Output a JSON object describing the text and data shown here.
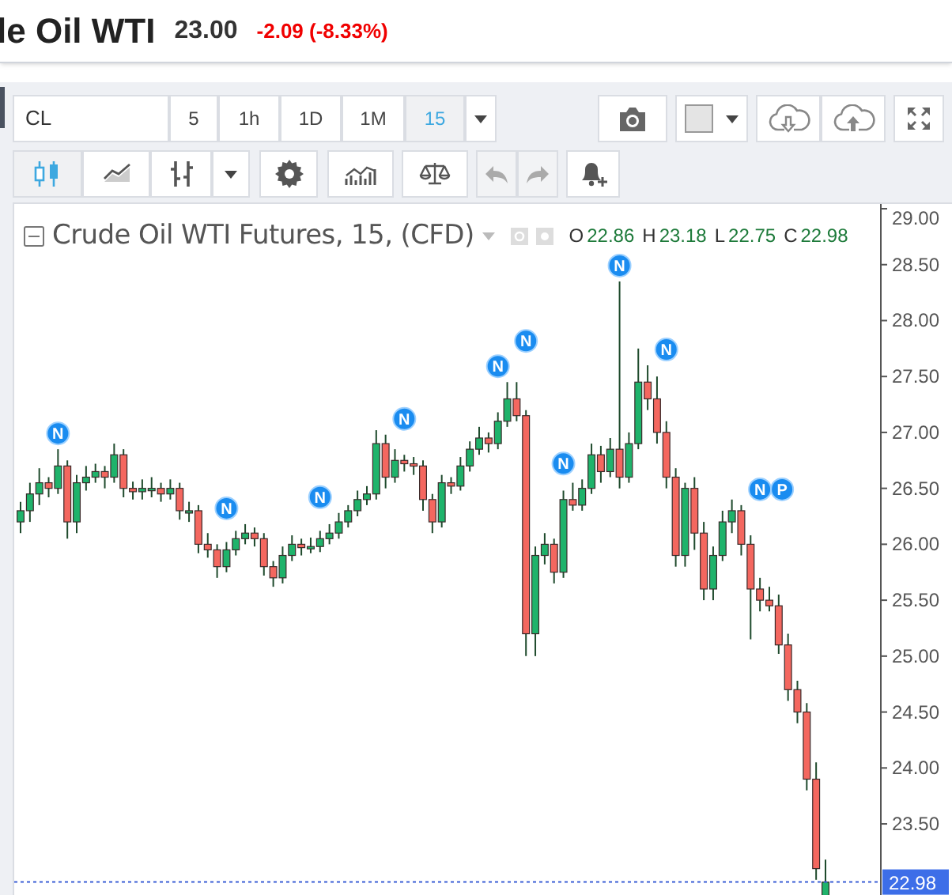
{
  "header": {
    "title": "le Oil WTI",
    "price": "23.00",
    "change": "-2.09 (-8.33%)"
  },
  "toolbar": {
    "symbol": "CL",
    "intervals": [
      {
        "label": "5",
        "selected": false
      },
      {
        "label": "1h",
        "selected": false
      },
      {
        "label": "1D",
        "selected": false
      },
      {
        "label": "1M",
        "selected": false
      },
      {
        "label": "15",
        "selected": true
      }
    ],
    "chart_types": [
      {
        "kind": "candles",
        "selected": true
      },
      {
        "kind": "line",
        "selected": false
      },
      {
        "kind": "bars",
        "selected": false
      }
    ]
  },
  "legend": {
    "title": "Crude Oil WTI Futures, 15, (CFD)",
    "ohlc": [
      {
        "key": "O",
        "value": "22.86"
      },
      {
        "key": "H",
        "value": "23.18"
      },
      {
        "key": "L",
        "value": "22.75"
      },
      {
        "key": "C",
        "value": "22.98"
      }
    ]
  },
  "chart_data": {
    "type": "candlestick",
    "ylim": [
      22.85,
      29.05
    ],
    "ref_lines": [
      {
        "axis": "y",
        "value": 22.98,
        "label": "22.98",
        "color": "#3b5fd6"
      }
    ],
    "yticks": [
      {
        "value": 29,
        "label": "29.00"
      },
      {
        "value": 28.5,
        "label": "28.50"
      },
      {
        "value": 28,
        "label": "28.00"
      },
      {
        "value": 27.5,
        "label": "27.50"
      },
      {
        "value": 27,
        "label": "27.00"
      },
      {
        "value": 26.5,
        "label": "26.50"
      },
      {
        "value": 26,
        "label": "26.00"
      },
      {
        "value": 25.5,
        "label": "25.50"
      },
      {
        "value": 25,
        "label": "25.00"
      },
      {
        "value": 24.5,
        "label": "24.50"
      },
      {
        "value": 24,
        "label": "24.00"
      },
      {
        "value": 23.5,
        "label": "23.50"
      }
    ],
    "ohlc": [
      [
        26.2,
        26.38,
        26.1,
        26.3
      ],
      [
        26.3,
        26.55,
        26.2,
        26.45
      ],
      [
        26.45,
        26.68,
        26.35,
        26.55
      ],
      [
        26.55,
        26.6,
        26.42,
        26.5
      ],
      [
        26.5,
        26.85,
        26.45,
        26.7
      ],
      [
        26.7,
        26.75,
        26.05,
        26.2
      ],
      [
        26.2,
        26.62,
        26.1,
        26.55
      ],
      [
        26.55,
        26.7,
        26.48,
        26.6
      ],
      [
        26.6,
        26.72,
        26.55,
        26.65
      ],
      [
        26.65,
        26.7,
        26.5,
        26.6
      ],
      [
        26.6,
        26.9,
        26.55,
        26.8
      ],
      [
        26.8,
        26.85,
        26.42,
        26.5
      ],
      [
        26.5,
        26.56,
        26.4,
        26.47
      ],
      [
        26.47,
        26.58,
        26.4,
        26.5
      ],
      [
        26.5,
        26.6,
        26.42,
        26.5
      ],
      [
        26.5,
        26.55,
        26.38,
        26.45
      ],
      [
        26.45,
        26.58,
        26.4,
        26.5
      ],
      [
        26.5,
        26.55,
        26.22,
        26.3
      ],
      [
        26.3,
        26.38,
        26.2,
        26.3
      ],
      [
        26.3,
        26.35,
        25.92,
        26.0
      ],
      [
        26.0,
        26.1,
        25.88,
        25.95
      ],
      [
        25.95,
        26.0,
        25.7,
        25.8
      ],
      [
        25.8,
        26.02,
        25.75,
        25.95
      ],
      [
        25.95,
        26.12,
        25.9,
        26.05
      ],
      [
        26.05,
        26.18,
        26.0,
        26.1
      ],
      [
        26.1,
        26.15,
        25.98,
        26.05
      ],
      [
        26.05,
        26.1,
        25.72,
        25.8
      ],
      [
        25.8,
        25.85,
        25.62,
        25.7
      ],
      [
        25.7,
        25.98,
        25.65,
        25.9
      ],
      [
        25.9,
        26.08,
        25.85,
        26.0
      ],
      [
        26.0,
        26.05,
        25.9,
        25.97
      ],
      [
        25.97,
        26.06,
        25.92,
        25.98
      ],
      [
        25.98,
        26.12,
        25.93,
        26.05
      ],
      [
        26.05,
        26.18,
        26.0,
        26.1
      ],
      [
        26.1,
        26.28,
        26.05,
        26.2
      ],
      [
        26.2,
        26.35,
        26.15,
        26.3
      ],
      [
        26.3,
        26.48,
        26.25,
        26.4
      ],
      [
        26.4,
        26.52,
        26.35,
        26.45
      ],
      [
        26.45,
        27.02,
        26.4,
        26.9
      ],
      [
        26.9,
        26.98,
        26.5,
        26.6
      ],
      [
        26.6,
        26.85,
        26.55,
        26.75
      ],
      [
        26.75,
        26.8,
        26.65,
        26.72
      ],
      [
        26.72,
        26.78,
        26.62,
        26.7
      ],
      [
        26.7,
        26.75,
        26.3,
        26.4
      ],
      [
        26.4,
        26.45,
        26.1,
        26.2
      ],
      [
        26.2,
        26.62,
        26.15,
        26.55
      ],
      [
        26.55,
        26.6,
        26.45,
        26.52
      ],
      [
        26.52,
        26.78,
        26.48,
        26.7
      ],
      [
        26.7,
        26.92,
        26.65,
        26.85
      ],
      [
        26.85,
        27.05,
        26.8,
        26.95
      ],
      [
        26.95,
        27.0,
        26.82,
        26.9
      ],
      [
        26.9,
        27.18,
        26.85,
        27.1
      ],
      [
        27.1,
        27.45,
        27.05,
        27.3
      ],
      [
        27.3,
        27.45,
        27.1,
        27.15
      ],
      [
        27.15,
        27.2,
        25.0,
        25.2
      ],
      [
        25.2,
        25.98,
        25.0,
        25.9
      ],
      [
        25.9,
        26.1,
        25.82,
        26.0
      ],
      [
        26.0,
        26.05,
        25.65,
        25.75
      ],
      [
        25.75,
        26.48,
        25.7,
        26.4
      ],
      [
        26.4,
        26.55,
        26.3,
        26.35
      ],
      [
        26.35,
        26.58,
        26.3,
        26.5
      ],
      [
        26.5,
        26.9,
        26.45,
        26.8
      ],
      [
        26.8,
        26.88,
        26.55,
        26.65
      ],
      [
        26.65,
        26.95,
        26.6,
        26.85
      ],
      [
        26.85,
        28.35,
        26.5,
        26.6
      ],
      [
        26.6,
        27.0,
        26.55,
        26.9
      ],
      [
        26.9,
        27.75,
        26.85,
        27.45
      ],
      [
        27.45,
        27.6,
        27.2,
        27.3
      ],
      [
        27.3,
        27.5,
        26.9,
        27.0
      ],
      [
        27.0,
        27.1,
        26.5,
        26.6
      ],
      [
        26.6,
        26.68,
        25.8,
        25.9
      ],
      [
        25.9,
        26.55,
        25.8,
        26.5
      ],
      [
        26.5,
        26.6,
        25.95,
        26.1
      ],
      [
        26.1,
        26.2,
        25.5,
        25.6
      ],
      [
        25.6,
        25.98,
        25.5,
        25.9
      ],
      [
        25.9,
        26.3,
        25.85,
        26.2
      ],
      [
        26.2,
        26.4,
        26.1,
        26.3
      ],
      [
        26.3,
        26.35,
        25.9,
        26.0
      ],
      [
        26.0,
        26.08,
        25.15,
        25.6
      ],
      [
        25.6,
        25.7,
        25.4,
        25.5
      ],
      [
        25.5,
        25.62,
        25.4,
        25.45
      ],
      [
        25.45,
        25.55,
        25.02,
        25.1
      ],
      [
        25.1,
        25.2,
        24.6,
        24.7
      ],
      [
        24.7,
        24.78,
        24.4,
        24.5
      ],
      [
        24.5,
        24.58,
        23.8,
        23.9
      ],
      [
        23.9,
        24.05,
        23.0,
        23.1
      ],
      [
        22.86,
        23.18,
        22.85,
        22.98
      ]
    ]
  },
  "markers": [
    "N",
    "N",
    "N",
    "N",
    "N",
    "N",
    "N",
    "N",
    "N",
    "N",
    "P"
  ]
}
